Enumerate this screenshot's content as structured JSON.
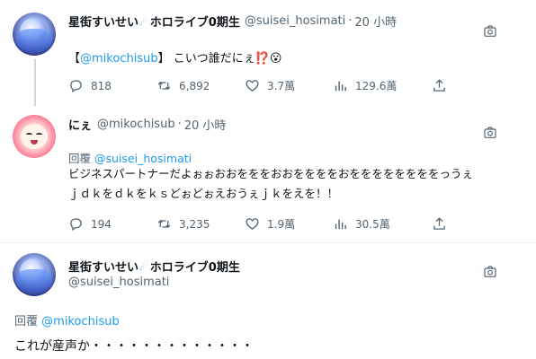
{
  "tweet1": {
    "display_name": "星街すいせい",
    "name_suffix": "ホロライブ0期生",
    "handle": "@suisei_hosimati",
    "dot": "·",
    "time": "20 小時",
    "bracket_open": "【",
    "mention": "@mikochisub",
    "bracket_close": "】",
    "body": "こいつ誰だにぇ",
    "emoji": "⁉️😮",
    "replies": "818",
    "retweets": "6,892",
    "likes": "3.7萬",
    "views": "129.6萬"
  },
  "tweet2": {
    "display_name": "にぇ",
    "handle": "@mikochisub",
    "dot": "·",
    "time": "20 小時",
    "reply_prefix": "回覆",
    "reply_target": "@suisei_hosimati",
    "line1": "ビジネスパートナーだよぉぉおおをををおおををををおををををををををっうぇ",
    "line2": "ｊｄｋをｄｋをｋｓどぉどぉえおうぇｊｋをえを！！",
    "replies": "194",
    "retweets": "3,235",
    "likes": "1.9萬",
    "views": "30.5萬"
  },
  "tweet3": {
    "display_name": "星街すいせい",
    "name_suffix": "ホロライブ0期生",
    "handle": "@suisei_hosimati",
    "reply_prefix": "回覆",
    "reply_target": "@mikochisub",
    "body": "これが産声か・・・・・・・・・・・・・"
  },
  "colors": {
    "accent": "#1d9bf0",
    "muted": "#536471",
    "text": "#0f1419",
    "line": "#cfd9de"
  }
}
